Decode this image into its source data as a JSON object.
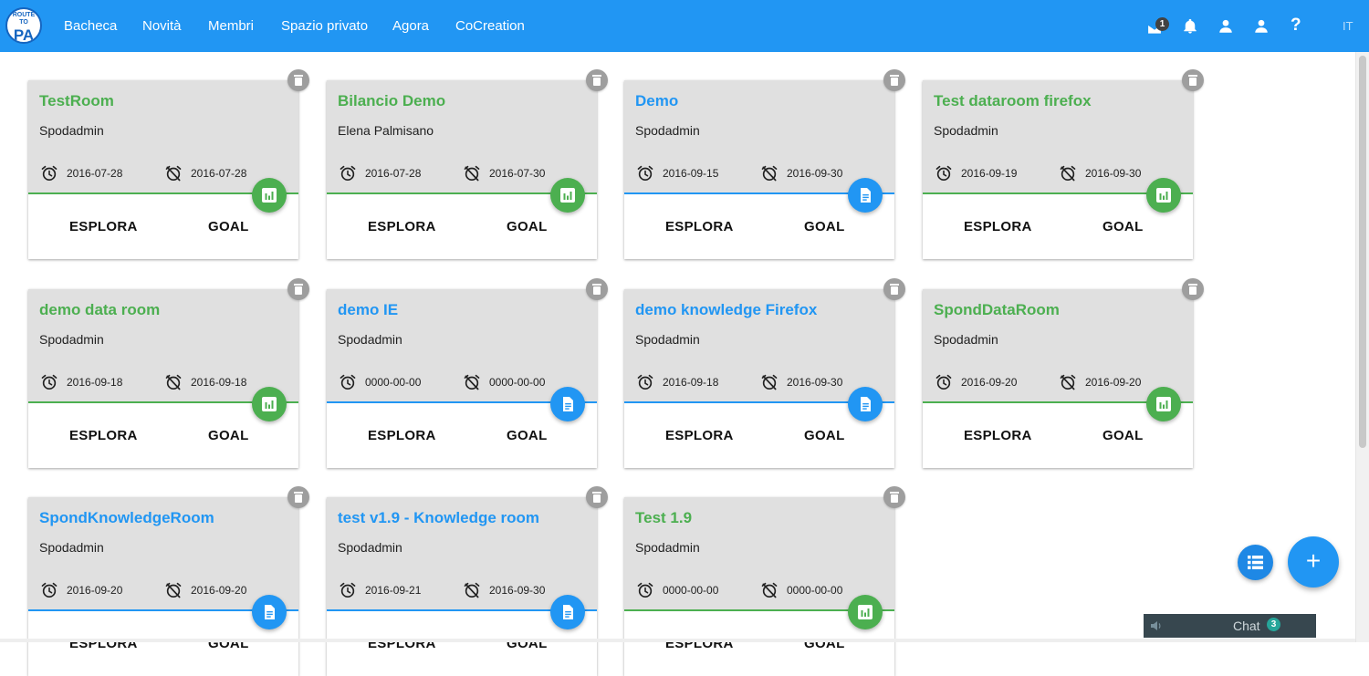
{
  "header": {
    "logo_top": "ROUTE TO",
    "logo_main": "PA",
    "nav": [
      "Bacheca",
      "Novità",
      "Membri",
      "Spazio privato",
      "Agora",
      "CoCreation"
    ],
    "mail_badge": "1",
    "help_label": "?",
    "language": "IT",
    "icons": [
      "mail-icon",
      "bell-icon",
      "person-icon",
      "person-icon",
      "help-icon"
    ]
  },
  "card_labels": {
    "explore": "ESPLORA",
    "goal": "GOAL"
  },
  "cards": [
    {
      "title": "TestRoom",
      "owner": "Spodadmin",
      "start": "2016-07-28",
      "end": "2016-07-28",
      "type": "data"
    },
    {
      "title": "Bilancio Demo",
      "owner": "Elena Palmisano",
      "start": "2016-07-28",
      "end": "2016-07-30",
      "type": "data"
    },
    {
      "title": "Demo",
      "owner": "Spodadmin",
      "start": "2016-09-15",
      "end": "2016-09-30",
      "type": "knowledge"
    },
    {
      "title": "Test dataroom firefox",
      "owner": "Spodadmin",
      "start": "2016-09-19",
      "end": "2016-09-30",
      "type": "data"
    },
    {
      "title": "demo data room",
      "owner": "Spodadmin",
      "start": "2016-09-18",
      "end": "2016-09-18",
      "type": "data"
    },
    {
      "title": "demo IE",
      "owner": "Spodadmin",
      "start": "0000-00-00",
      "end": "0000-00-00",
      "type": "knowledge"
    },
    {
      "title": "demo knowledge Firefox",
      "owner": "Spodadmin",
      "start": "2016-09-18",
      "end": "2016-09-30",
      "type": "knowledge"
    },
    {
      "title": "SpondDataRoom",
      "owner": "Spodadmin",
      "start": "2016-09-20",
      "end": "2016-09-20",
      "type": "data"
    },
    {
      "title": "SpondKnowledgeRoom",
      "owner": "Spodadmin",
      "start": "2016-09-20",
      "end": "2016-09-20",
      "type": "knowledge"
    },
    {
      "title": "test v1.9 - Knowledge room",
      "owner": "Spodadmin",
      "start": "2016-09-21",
      "end": "2016-09-30",
      "type": "knowledge"
    },
    {
      "title": "Test 1.9",
      "owner": "Spodadmin",
      "start": "0000-00-00",
      "end": "0000-00-00",
      "type": "data"
    }
  ],
  "colors": {
    "header_bg": "#2196f3",
    "data_room": "#4caf50",
    "knowledge_room": "#2196f3",
    "card_head_bg": "#e0e0e0"
  },
  "fab": {
    "add_label": "+"
  },
  "chat": {
    "label": "Chat",
    "badge": "3"
  }
}
